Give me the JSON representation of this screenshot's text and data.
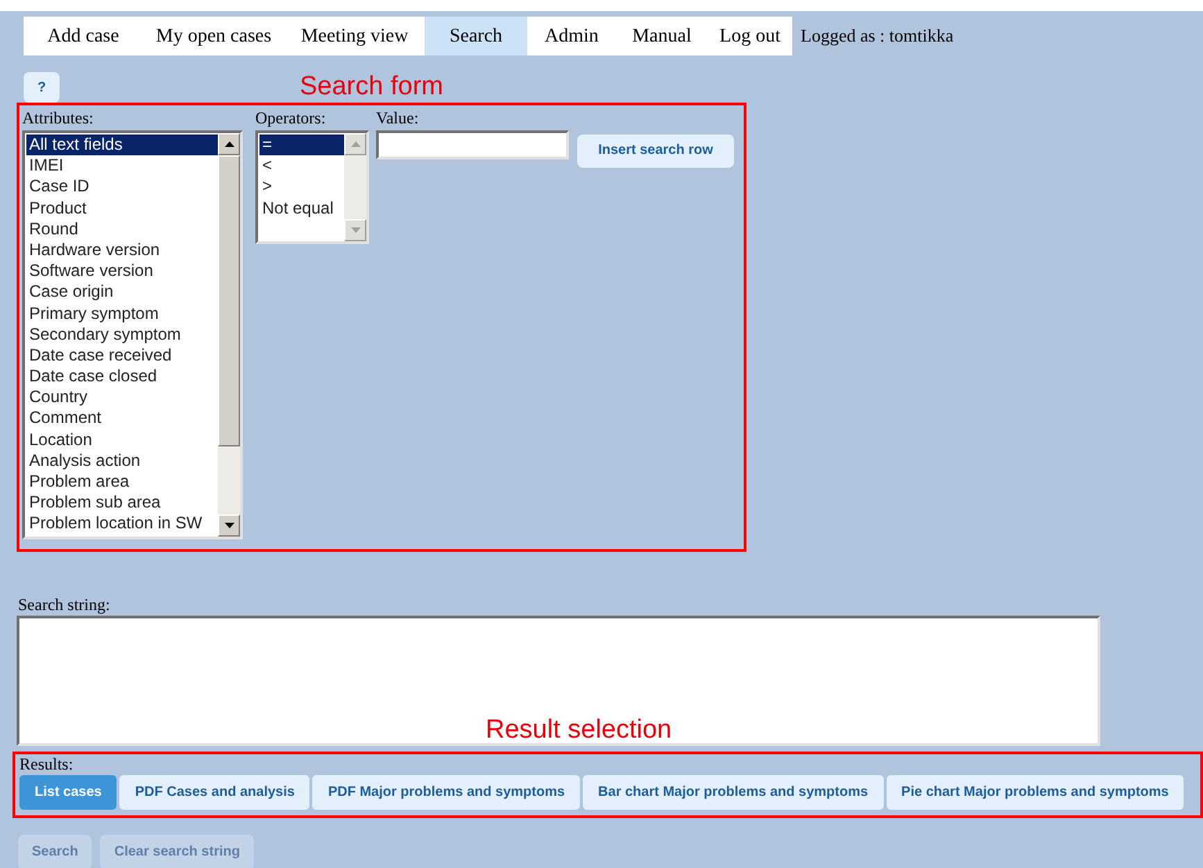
{
  "nav": {
    "tabs": [
      {
        "label": "Add case",
        "selected": false
      },
      {
        "label": "My open cases",
        "selected": false
      },
      {
        "label": "Meeting view",
        "selected": false
      },
      {
        "label": "Search",
        "selected": true
      },
      {
        "label": "Admin",
        "selected": false
      },
      {
        "label": "Manual",
        "selected": false
      },
      {
        "label": "Log out",
        "selected": false
      }
    ],
    "logged_as": "Logged as : tomtikka"
  },
  "help_button": "?",
  "annotations": {
    "search_form": "Search form",
    "result_selection": "Result selection"
  },
  "search_form": {
    "attributes_label": "Attributes:",
    "attributes": [
      {
        "label": "All text fields",
        "selected": true
      },
      {
        "label": "IMEI",
        "selected": false
      },
      {
        "label": "Case ID",
        "selected": false
      },
      {
        "label": "Product",
        "selected": false
      },
      {
        "label": "Round",
        "selected": false
      },
      {
        "label": "Hardware version",
        "selected": false
      },
      {
        "label": "Software version",
        "selected": false
      },
      {
        "label": "Case origin",
        "selected": false
      },
      {
        "label": "Primary symptom",
        "selected": false
      },
      {
        "label": "Secondary symptom",
        "selected": false
      },
      {
        "label": "Date case received",
        "selected": false
      },
      {
        "label": "Date case closed",
        "selected": false
      },
      {
        "label": "Country",
        "selected": false
      },
      {
        "label": "Comment",
        "selected": false
      },
      {
        "label": "Location",
        "selected": false
      },
      {
        "label": "Analysis action",
        "selected": false
      },
      {
        "label": "Problem area",
        "selected": false
      },
      {
        "label": "Problem sub area",
        "selected": false
      },
      {
        "label": "Problem location in SW",
        "selected": false
      }
    ],
    "operators_label": "Operators:",
    "operators": [
      {
        "label": "=",
        "selected": true
      },
      {
        "label": "<",
        "selected": false
      },
      {
        "label": ">",
        "selected": false
      },
      {
        "label": "Not equal",
        "selected": false
      }
    ],
    "value_label": "Value:",
    "insert_button": "Insert search row"
  },
  "search_string_label": "Search string:",
  "results_label": "Results:",
  "results": [
    {
      "label": "List cases",
      "selected": true
    },
    {
      "label": "PDF Cases and analysis",
      "selected": false
    },
    {
      "label": "PDF Major problems and symptoms",
      "selected": false
    },
    {
      "label": "Bar chart Major problems and symptoms",
      "selected": false
    },
    {
      "label": "Pie chart Major problems and symptoms",
      "selected": false
    }
  ],
  "actions": [
    {
      "label": "Search",
      "disabled": true
    },
    {
      "label": "Clear search string",
      "disabled": true
    }
  ]
}
